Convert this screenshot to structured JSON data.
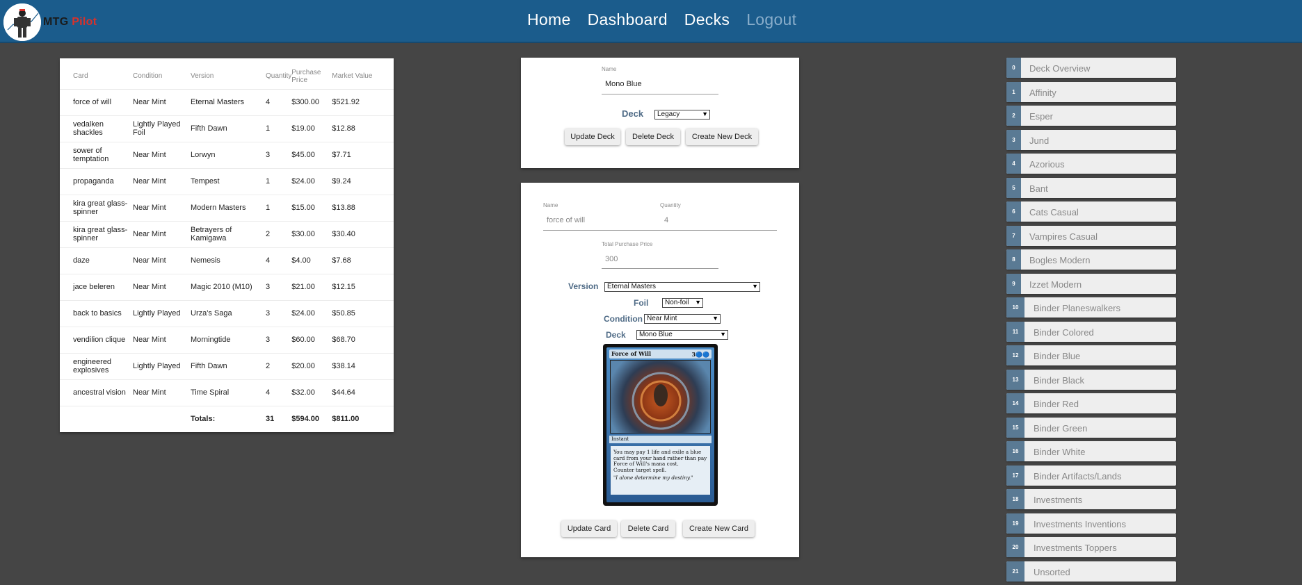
{
  "brand": {
    "part1": "MTG",
    "part2": "Pilot"
  },
  "nav": [
    "Home",
    "Dashboard",
    "Decks",
    "Logout"
  ],
  "table": {
    "headers": [
      "Card",
      "Condition",
      "Version",
      "Quantity",
      "Purchase Price",
      "Market Value"
    ],
    "rows": [
      [
        "force of will",
        "Near Mint",
        "Eternal Masters",
        "4",
        "$300.00",
        "$521.92"
      ],
      [
        "vedalken shackles",
        "Lightly Played Foil",
        "Fifth Dawn",
        "1",
        "$19.00",
        "$12.88"
      ],
      [
        "sower of temptation",
        "Near Mint",
        "Lorwyn",
        "3",
        "$45.00",
        "$7.71"
      ],
      [
        "propaganda",
        "Near Mint",
        "Tempest",
        "1",
        "$24.00",
        "$9.24"
      ],
      [
        "kira great glass-spinner",
        "Near Mint",
        "Modern Masters",
        "1",
        "$15.00",
        "$13.88"
      ],
      [
        "kira great glass-spinner",
        "Near Mint",
        "Betrayers of Kamigawa",
        "2",
        "$30.00",
        "$30.40"
      ],
      [
        "daze",
        "Near Mint",
        "Nemesis",
        "4",
        "$4.00",
        "$7.68"
      ],
      [
        "jace beleren",
        "Near Mint",
        "Magic 2010 (M10)",
        "3",
        "$21.00",
        "$12.15"
      ],
      [
        "back to basics",
        "Lightly Played",
        "Urza's Saga",
        "3",
        "$24.00",
        "$50.85"
      ],
      [
        "vendilion clique",
        "Near Mint",
        "Morningtide",
        "3",
        "$60.00",
        "$68.70"
      ],
      [
        "engineered explosives",
        "Lightly Played",
        "Fifth Dawn",
        "2",
        "$20.00",
        "$38.14"
      ],
      [
        "ancestral vision",
        "Near Mint",
        "Time Spiral",
        "4",
        "$32.00",
        "$44.64"
      ]
    ],
    "totals": {
      "label": "Totals:",
      "quantity": "31",
      "purchase": "$594.00",
      "market": "$811.00"
    }
  },
  "deck_form": {
    "name_label": "Name",
    "name_value": "Mono Blue",
    "deck_label": "Deck",
    "deck_select": "Legacy",
    "buttons": [
      "Update Deck",
      "Delete Deck",
      "Create New Deck"
    ]
  },
  "card_form": {
    "name_label": "Name",
    "name_value": "force of will",
    "quantity_label": "Quantity",
    "quantity_value": "4",
    "total_label": "Total Purchase Price",
    "total_value": "300",
    "version_label": "Version",
    "version_select": "Eternal Masters",
    "foil_label": "Foil",
    "foil_select": "Non-foil",
    "condition_label": "Condition",
    "condition_select": "Near Mint",
    "deck_label": "Deck",
    "deck_select": "Mono Blue",
    "buttons": [
      "Update Card",
      "Delete Card",
      "Create New Card"
    ]
  },
  "mtg_card": {
    "name": "Force of Will",
    "mana": "3🔵🔵",
    "type": "Instant",
    "rules": "You may pay 1 life and exile a blue card from your hand rather than pay Force of Will's mana cost.",
    "rules2": "Counter target spell.",
    "flavor": "\"I alone determine my destiny.\""
  },
  "decks": [
    {
      "index": "0",
      "name": "Deck Overview"
    },
    {
      "index": "1",
      "name": "Affinity"
    },
    {
      "index": "2",
      "name": "Esper"
    },
    {
      "index": "3",
      "name": "Jund"
    },
    {
      "index": "4",
      "name": "Azorious"
    },
    {
      "index": "5",
      "name": "Bant"
    },
    {
      "index": "6",
      "name": "Cats Casual"
    },
    {
      "index": "7",
      "name": "Vampires Casual"
    },
    {
      "index": "8",
      "name": "Bogles Modern"
    },
    {
      "index": "9",
      "name": "Izzet Modern"
    },
    {
      "index": "10",
      "name": "Binder Planeswalkers"
    },
    {
      "index": "11",
      "name": "Binder Colored"
    },
    {
      "index": "12",
      "name": "Binder Blue"
    },
    {
      "index": "13",
      "name": "Binder Black"
    },
    {
      "index": "14",
      "name": "Binder Red"
    },
    {
      "index": "15",
      "name": "Binder Green"
    },
    {
      "index": "16",
      "name": "Binder White"
    },
    {
      "index": "17",
      "name": "Binder Artifacts/Lands"
    },
    {
      "index": "18",
      "name": "Investments"
    },
    {
      "index": "19",
      "name": "Investments Inventions"
    },
    {
      "index": "20",
      "name": "Investments Toppers"
    },
    {
      "index": "21",
      "name": "Unsorted"
    }
  ],
  "colors": {
    "navbar": "#1b5c8c",
    "background": "#454545",
    "accent_red": "#d9312a",
    "badge": "#5a7a94"
  }
}
